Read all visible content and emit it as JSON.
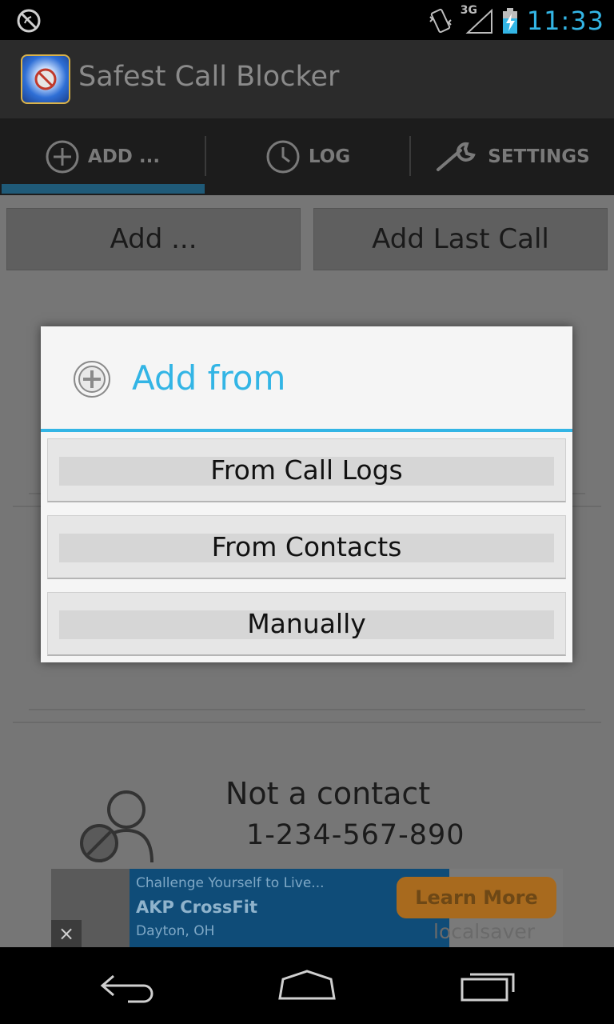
{
  "status_bar": {
    "time": "11:33",
    "network": "3G",
    "icons": [
      "blocked-circle-icon",
      "vibrate-icon",
      "signal-icon",
      "battery-charging-icon"
    ]
  },
  "app": {
    "title": "Safest Call Blocker",
    "icon": "shield-phone-icon"
  },
  "tabs": [
    {
      "label": "ADD ...",
      "icon": "plus-circle-icon",
      "selected": true
    },
    {
      "label": "LOG",
      "icon": "clock-icon",
      "selected": false
    },
    {
      "label": "SETTINGS",
      "icon": "wrench-icon",
      "selected": false
    }
  ],
  "actions": {
    "add_label": "Add ...",
    "add_last_call_label": "Add Last Call"
  },
  "contact": {
    "name": "Not a contact",
    "number": "1-234-567-890",
    "icon": "blocked-person-icon"
  },
  "ad": {
    "line1": "Challenge Yourself to Live...",
    "line2": "AKP CrossFit",
    "line3": "Dayton, OH",
    "cta": "Learn More",
    "brand": "localsaver",
    "close": "×"
  },
  "dialog": {
    "title": "Add from",
    "icon": "plus-circle-icon",
    "options": [
      "From Call Logs",
      "From Contacts",
      "Manually"
    ]
  },
  "nav": {
    "icons": [
      "back-icon",
      "home-icon",
      "recent-apps-icon"
    ]
  },
  "colors": {
    "accent": "#33b5e5",
    "status_clock": "#33b5e5"
  }
}
